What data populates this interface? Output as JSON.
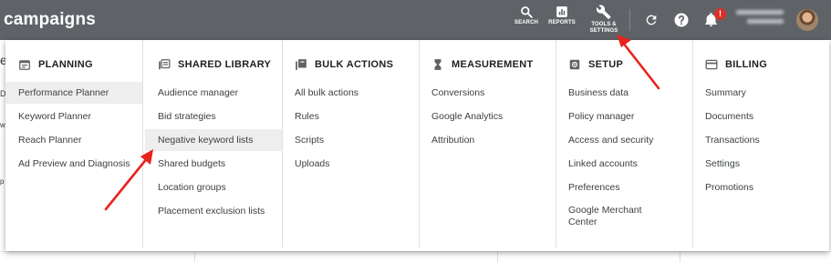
{
  "header": {
    "title": "campaigns",
    "tools": [
      {
        "label": "SEARCH",
        "icon": "search-icon"
      },
      {
        "label": "REPORTS",
        "icon": "reports-icon"
      },
      {
        "label": "TOOLS &\nSETTINGS",
        "icon": "wrench-icon"
      }
    ],
    "notification_badge": "!",
    "colors": {
      "bar": "#5f6368",
      "badge": "#d93025",
      "annotation": "#e8231c"
    }
  },
  "underlying_page": {
    "peek_text": [
      "e",
      "D",
      "w",
      "p"
    ]
  },
  "menu": {
    "columns": [
      {
        "heading": "PLANNING",
        "icon": "calendar-icon",
        "items": [
          "Performance Planner",
          "Keyword Planner",
          "Reach Planner",
          "Ad Preview and Diagnosis"
        ],
        "highlighted": 0
      },
      {
        "heading": "SHARED LIBRARY",
        "icon": "library-icon",
        "items": [
          "Audience manager",
          "Bid strategies",
          "Negative keyword lists",
          "Shared budgets",
          "Location groups",
          "Placement exclusion lists"
        ],
        "highlighted": 2
      },
      {
        "heading": "BULK ACTIONS",
        "icon": "copy-icon",
        "items": [
          "All bulk actions",
          "Rules",
          "Scripts",
          "Uploads"
        ]
      },
      {
        "heading": "MEASUREMENT",
        "icon": "hourglass-icon",
        "items": [
          "Conversions",
          "Google Analytics",
          "Attribution"
        ]
      },
      {
        "heading": "SETUP",
        "icon": "setup-icon",
        "items": [
          "Business data",
          "Policy manager",
          "Access and security",
          "Linked accounts",
          "Preferences",
          "Google Merchant Center"
        ]
      },
      {
        "heading": "BILLING",
        "icon": "card-icon",
        "items": [
          "Summary",
          "Documents",
          "Transactions",
          "Settings",
          "Promotions"
        ]
      }
    ]
  }
}
